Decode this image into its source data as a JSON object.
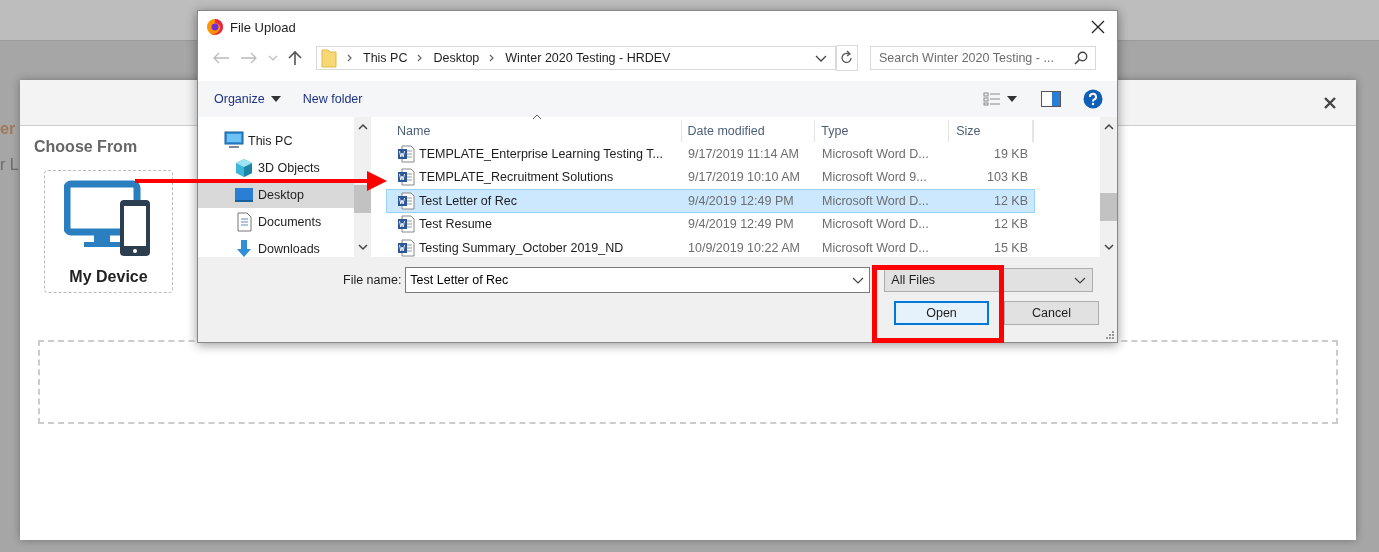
{
  "background_fragments": [
    {
      "text": "er",
      "kind": "heading"
    },
    {
      "text": "r L",
      "kind": "plain"
    }
  ],
  "upload_modal": {
    "section_title": "Choose From",
    "sources": [
      {
        "label": "My Device",
        "kind": "device"
      }
    ]
  },
  "dialog": {
    "title": "File Upload",
    "breadcrumb": [
      "This PC",
      "Desktop",
      "Winter 2020 Testing - HRDEV"
    ],
    "search": {
      "placeholder": "Search Winter 2020 Testing - ..."
    },
    "toolbar": {
      "organize": "Organize",
      "new_folder": "New folder"
    },
    "nav": [
      {
        "label": "This PC",
        "kind": "pc",
        "selected": false,
        "children": [
          {
            "label": "3D Objects",
            "kind": "cube",
            "selected": false
          },
          {
            "label": "Desktop",
            "kind": "desktop",
            "selected": true
          },
          {
            "label": "Documents",
            "kind": "documents",
            "selected": false
          },
          {
            "label": "Downloads",
            "kind": "downloads",
            "selected": false
          }
        ]
      }
    ],
    "columns": [
      "Name",
      "Date modified",
      "Type",
      "Size"
    ],
    "files": [
      {
        "name": "TEMPLATE_Enterprise Learning Testing T...",
        "date": "9/17/2019 11:14 AM",
        "type": "Microsoft Word D...",
        "size": "19 KB",
        "selected": false
      },
      {
        "name": "TEMPLATE_Recruitment Solutions",
        "date": "9/17/2019 10:10 AM",
        "type": "Microsoft Word 9...",
        "size": "103 KB",
        "selected": false
      },
      {
        "name": "Test Letter of Rec",
        "date": "9/4/2019 12:49 PM",
        "type": "Microsoft Word D...",
        "size": "12 KB",
        "selected": true
      },
      {
        "name": "Test Resume",
        "date": "9/4/2019 12:49 PM",
        "type": "Microsoft Word D...",
        "size": "12 KB",
        "selected": false
      },
      {
        "name": "Testing Summary_October 2019_ND",
        "date": "10/9/2019 10:22 AM",
        "type": "Microsoft Word D...",
        "size": "15 KB",
        "selected": false
      }
    ],
    "file_name_label": "File name:",
    "file_name": "Test Letter of Rec",
    "file_type": "All Files",
    "buttons": [
      {
        "label": "Open",
        "kind": "default"
      },
      {
        "label": "Cancel",
        "kind": "normal"
      }
    ]
  },
  "annotations": [
    {
      "kind": "arrow"
    },
    {
      "kind": "box"
    }
  ]
}
